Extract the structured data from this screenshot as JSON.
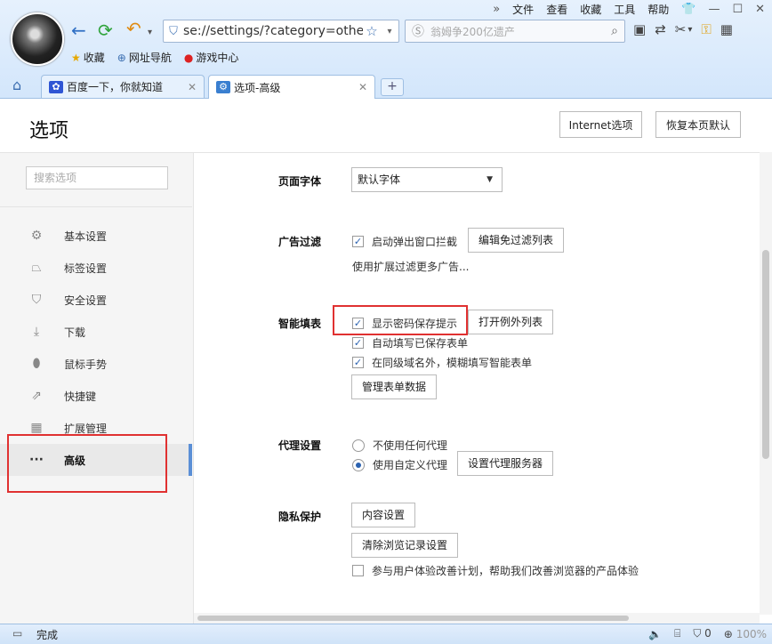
{
  "menu": {
    "items": [
      "文件",
      "查看",
      "收藏",
      "工具",
      "帮助"
    ]
  },
  "address": {
    "url": "se://settings/?category=othe"
  },
  "search": {
    "placeholder": "翁姆争200亿遗产"
  },
  "favorites": [
    {
      "label": "收藏",
      "icon": "star-icon"
    },
    {
      "label": "网址导航",
      "icon": "globe-icon"
    },
    {
      "label": "游戏中心",
      "icon": "game-icon"
    }
  ],
  "tabs": [
    {
      "label": "百度一下，你就知道"
    },
    {
      "label": "选项-高级"
    }
  ],
  "page": {
    "title": "选项",
    "internet_options": "Internet选项",
    "restore_defaults": "恢复本页默认"
  },
  "sidebar": {
    "search_placeholder": "搜索选项",
    "items": [
      {
        "label": "基本设置",
        "icon": "gear-icon"
      },
      {
        "label": "标签设置",
        "icon": "tab-icon"
      },
      {
        "label": "安全设置",
        "icon": "shield-icon"
      },
      {
        "label": "下载",
        "icon": "download-icon"
      },
      {
        "label": "鼠标手势",
        "icon": "mouse-icon"
      },
      {
        "label": "快捷键",
        "icon": "shortcut-icon"
      },
      {
        "label": "扩展管理",
        "icon": "extensions-icon"
      },
      {
        "label": "高级",
        "icon": "more-icon"
      }
    ]
  },
  "sections": {
    "font": {
      "title": "页面字体",
      "value": "默认字体"
    },
    "ad_filter": {
      "title": "广告过滤",
      "popup_block": "启动弹出窗口拦截",
      "edit_list": "编辑免过滤列表",
      "note": "使用扩展过滤更多广告..."
    },
    "autofill": {
      "title": "智能填表",
      "show_password": "显示密码保存提示",
      "open_exceptions": "打开例外列表",
      "autofill_saved": "自动填写已保存表单",
      "fuzzy_fill": "在同级域名外，模糊填写智能表单",
      "manage": "管理表单数据"
    },
    "proxy": {
      "title": "代理设置",
      "no_proxy": "不使用任何代理",
      "custom_proxy": "使用自定义代理",
      "set_server": "设置代理服务器"
    },
    "privacy": {
      "title": "隐私保护",
      "content_settings": "内容设置",
      "clear_history": "清除浏览记录设置",
      "join_program": "参与用户体验改善计划，帮助我们改善浏览器的产品体验"
    }
  },
  "checkbox_states": {
    "popup_block": true,
    "show_password": true,
    "autofill_saved": true,
    "fuzzy_fill": true,
    "join_program": false
  },
  "proxy_selected": "custom_proxy",
  "status": {
    "text": "完成",
    "security_count": "0",
    "zoom": "100%"
  },
  "colors": {
    "accent": "#5b8fd6",
    "highlight_box": "#e03131",
    "chrome": "#d3e6fb"
  }
}
